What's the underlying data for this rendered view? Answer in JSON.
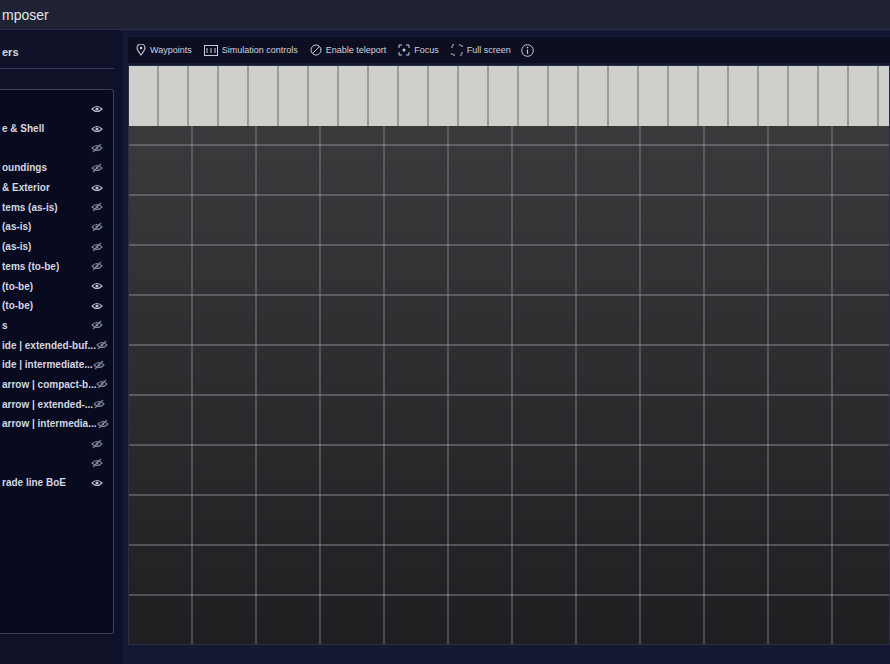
{
  "window": {
    "title": "mposer"
  },
  "sidebar": {
    "title": "ers",
    "layers": [
      {
        "label": "",
        "visible": true
      },
      {
        "label": "e & Shell",
        "visible": true
      },
      {
        "label": "",
        "visible": false
      },
      {
        "label": "oundings",
        "visible": false
      },
      {
        "label": "& Exterior",
        "visible": true
      },
      {
        "label": "tems (as-is)",
        "visible": false
      },
      {
        "label": "(as-is)",
        "visible": false
      },
      {
        "label": "(as-is)",
        "visible": false
      },
      {
        "label": "tems (to-be)",
        "visible": false
      },
      {
        "label": "(to-be)",
        "visible": true
      },
      {
        "label": "(to-be)",
        "visible": true
      },
      {
        "label": "s",
        "visible": false
      },
      {
        "label": "ide | extended-buf...",
        "visible": false
      },
      {
        "label": "ide | intermediate...",
        "visible": false
      },
      {
        "label": "arrow | compact-b...",
        "visible": false
      },
      {
        "label": "arrow | extended-...",
        "visible": false
      },
      {
        "label": "arrow | intermedia...",
        "visible": false
      },
      {
        "label": "",
        "visible": false
      },
      {
        "label": "",
        "visible": false
      },
      {
        "label": "rade line BoE",
        "visible": true
      }
    ]
  },
  "toolbar": {
    "buttons": [
      {
        "label": "Waypoints",
        "kind": "pin"
      },
      {
        "label": "Simulation controls",
        "kind": "sim"
      },
      {
        "label": "Enable teleport",
        "kind": "teleport"
      },
      {
        "label": "Focus",
        "kind": "focus"
      },
      {
        "label": "Full screen",
        "kind": "fullscreen"
      }
    ]
  }
}
